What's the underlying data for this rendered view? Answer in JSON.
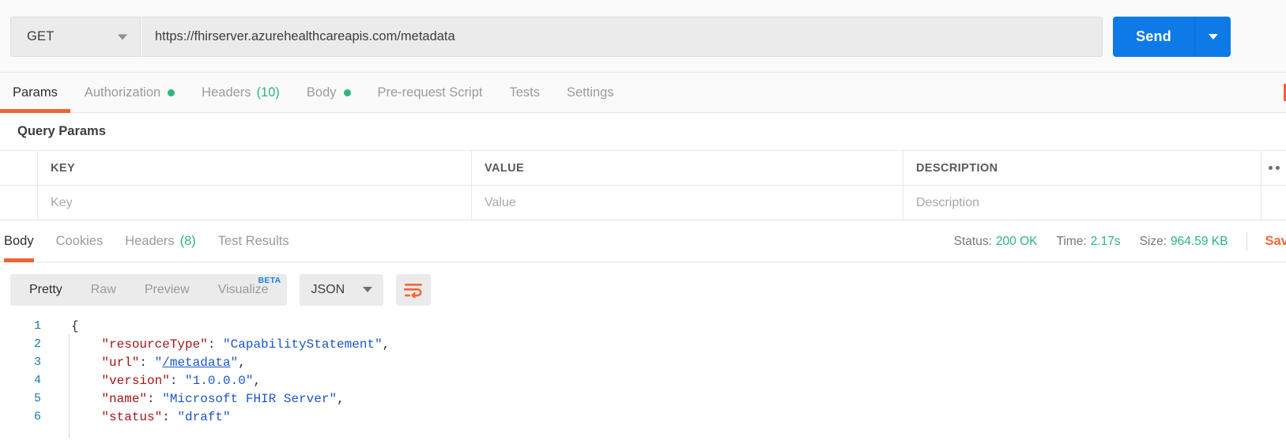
{
  "request": {
    "method": "GET",
    "url": "https://fhirserver.azurehealthcareapis.com/metadata",
    "send_label": "Send",
    "tabs": [
      {
        "label": "Params",
        "active": true,
        "dot": false,
        "count": ""
      },
      {
        "label": "Authorization",
        "active": false,
        "dot": true,
        "count": ""
      },
      {
        "label": "Headers",
        "active": false,
        "dot": false,
        "count": "(10)"
      },
      {
        "label": "Body",
        "active": false,
        "dot": true,
        "count": ""
      },
      {
        "label": "Pre-request Script",
        "active": false,
        "dot": false,
        "count": ""
      },
      {
        "label": "Tests",
        "active": false,
        "dot": false,
        "count": ""
      },
      {
        "label": "Settings",
        "active": false,
        "dot": false,
        "count": ""
      }
    ]
  },
  "query_params": {
    "section_title": "Query Params",
    "columns": [
      "KEY",
      "VALUE",
      "DESCRIPTION"
    ],
    "placeholder_row": {
      "key": "Key",
      "value": "Value",
      "description": "Description"
    }
  },
  "response": {
    "tabs": [
      {
        "label": "Body",
        "active": true,
        "count": ""
      },
      {
        "label": "Cookies",
        "active": false,
        "count": ""
      },
      {
        "label": "Headers",
        "active": false,
        "count": "(8)"
      },
      {
        "label": "Test Results",
        "active": false,
        "count": ""
      }
    ],
    "status_label": "Status:",
    "status_value": "200 OK",
    "time_label": "Time:",
    "time_value": "2.17s",
    "size_label": "Size:",
    "size_value": "964.59 KB",
    "save_label": "Save",
    "format_tabs": [
      {
        "label": "Pretty",
        "active": true,
        "beta": ""
      },
      {
        "label": "Raw",
        "active": false,
        "beta": ""
      },
      {
        "label": "Preview",
        "active": false,
        "beta": ""
      },
      {
        "label": "Visualize",
        "active": false,
        "beta": "BETA"
      }
    ],
    "language": "JSON",
    "body_lines": [
      {
        "n": "1",
        "tokens": [
          {
            "t": "{",
            "c": "p"
          }
        ]
      },
      {
        "n": "2",
        "tokens": [
          {
            "t": "    \"resourceType\"",
            "c": "k"
          },
          {
            "t": ": ",
            "c": "p"
          },
          {
            "t": "\"CapabilityStatement\"",
            "c": "s"
          },
          {
            "t": ",",
            "c": "p"
          }
        ]
      },
      {
        "n": "3",
        "tokens": [
          {
            "t": "    \"url\"",
            "c": "k"
          },
          {
            "t": ": ",
            "c": "p"
          },
          {
            "t": "\"",
            "c": "s"
          },
          {
            "t": "/metadata",
            "c": "lnk"
          },
          {
            "t": "\"",
            "c": "s"
          },
          {
            "t": ",",
            "c": "p"
          }
        ]
      },
      {
        "n": "4",
        "tokens": [
          {
            "t": "    \"version\"",
            "c": "k"
          },
          {
            "t": ": ",
            "c": "p"
          },
          {
            "t": "\"1.0.0.0\"",
            "c": "s"
          },
          {
            "t": ",",
            "c": "p"
          }
        ]
      },
      {
        "n": "5",
        "tokens": [
          {
            "t": "    \"name\"",
            "c": "k"
          },
          {
            "t": ": ",
            "c": "p"
          },
          {
            "t": "\"Microsoft FHIR Server\"",
            "c": "s"
          },
          {
            "t": ",",
            "c": "p"
          }
        ]
      },
      {
        "n": "6",
        "tokens": [
          {
            "t": "    \"status\"",
            "c": "k"
          },
          {
            "t": ": ",
            "c": "p"
          },
          {
            "t": "\"draft\"",
            "c": "s"
          }
        ]
      }
    ]
  },
  "colors": {
    "accent_orange": "#ef6334",
    "send_blue": "#0d7ae8",
    "status_green": "#2db47d",
    "beta_blue": "#1b82e2",
    "json_key": "#a31515",
    "json_string": "#1a56c4",
    "line_number": "#1a7ba8"
  }
}
